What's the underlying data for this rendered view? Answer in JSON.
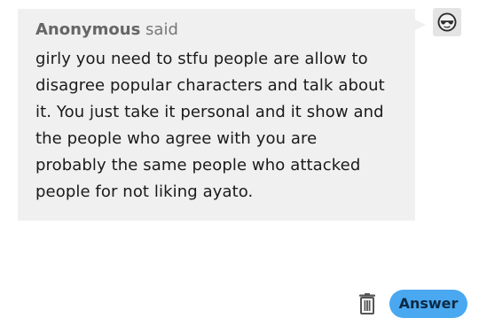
{
  "ask": {
    "asker_name": "Anonymous",
    "said_label": "said",
    "question": "girly you need to stfu people are allow to\ndisagree popular characters and talk about\nit. You just take it personal and it show and\nthe people who agree with you are\nprobably the same people who attacked\npeople for not liking ayato."
  },
  "avatar": {
    "icon": "sunglasses-face-icon"
  },
  "actions": {
    "delete_icon": "trash-icon",
    "answer_label": "Answer"
  },
  "colors": {
    "bubble_background": "#f0f0f0",
    "answer_button": "#4aa8f0",
    "answer_text": "#0b2a45"
  }
}
